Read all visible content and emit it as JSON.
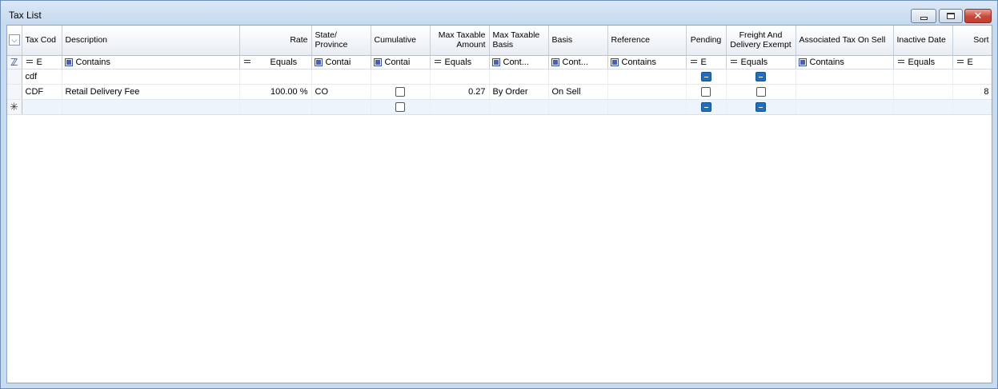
{
  "window": {
    "title": "Tax List",
    "buttons": {
      "minimize": "—",
      "maximize": "□",
      "close": "✕"
    }
  },
  "columns": [
    {
      "key": "tax_code",
      "label": "Tax Cod"
    },
    {
      "key": "description",
      "label": "Description"
    },
    {
      "key": "rate",
      "label": "Rate"
    },
    {
      "key": "state",
      "label": "State/ Province"
    },
    {
      "key": "cumulative",
      "label": "Cumulative"
    },
    {
      "key": "max_amount",
      "label": "Max Taxable Amount"
    },
    {
      "key": "max_basis",
      "label": "Max Taxable Basis"
    },
    {
      "key": "basis",
      "label": "Basis"
    },
    {
      "key": "reference",
      "label": "Reference"
    },
    {
      "key": "pending",
      "label": "Pending"
    },
    {
      "key": "freight",
      "label": "Freight And Delivery Exempt"
    },
    {
      "key": "assoc_tax",
      "label": "Associated Tax On Sell"
    },
    {
      "key": "inactive_date",
      "label": "Inactive Date"
    },
    {
      "key": "sort",
      "label": "Sort"
    }
  ],
  "filters": {
    "tax_code": "E",
    "description": "Contains",
    "rate": "Equals",
    "state": "Contai",
    "cumulative": "Contai",
    "max_amount": "Equals",
    "max_basis": "Cont...",
    "basis": "Cont...",
    "reference": "Contains",
    "pending": "E",
    "freight": "Equals",
    "assoc_tax": "Contains",
    "inactive_date": "Equals",
    "sort": "E"
  },
  "search_row": {
    "tax_code": "cdf",
    "pending": "indeterminate",
    "freight": "indeterminate"
  },
  "rows": [
    {
      "tax_code": "CDF",
      "description": "Retail Delivery Fee",
      "rate": "100.00 %",
      "state": "CO",
      "cumulative": false,
      "max_amount": "0.27",
      "max_basis": "By Order",
      "basis": "On Sell",
      "reference": "",
      "pending": false,
      "freight": false,
      "assoc_tax": "",
      "inactive_date": "",
      "sort": "8"
    }
  ],
  "new_row": {
    "cumulative": false,
    "pending": "indeterminate",
    "freight": "indeterminate"
  },
  "icons": {
    "column_chooser": "chevron-down-icon",
    "filter_row": "filter-icon",
    "new_row": "asterisk-icon"
  }
}
